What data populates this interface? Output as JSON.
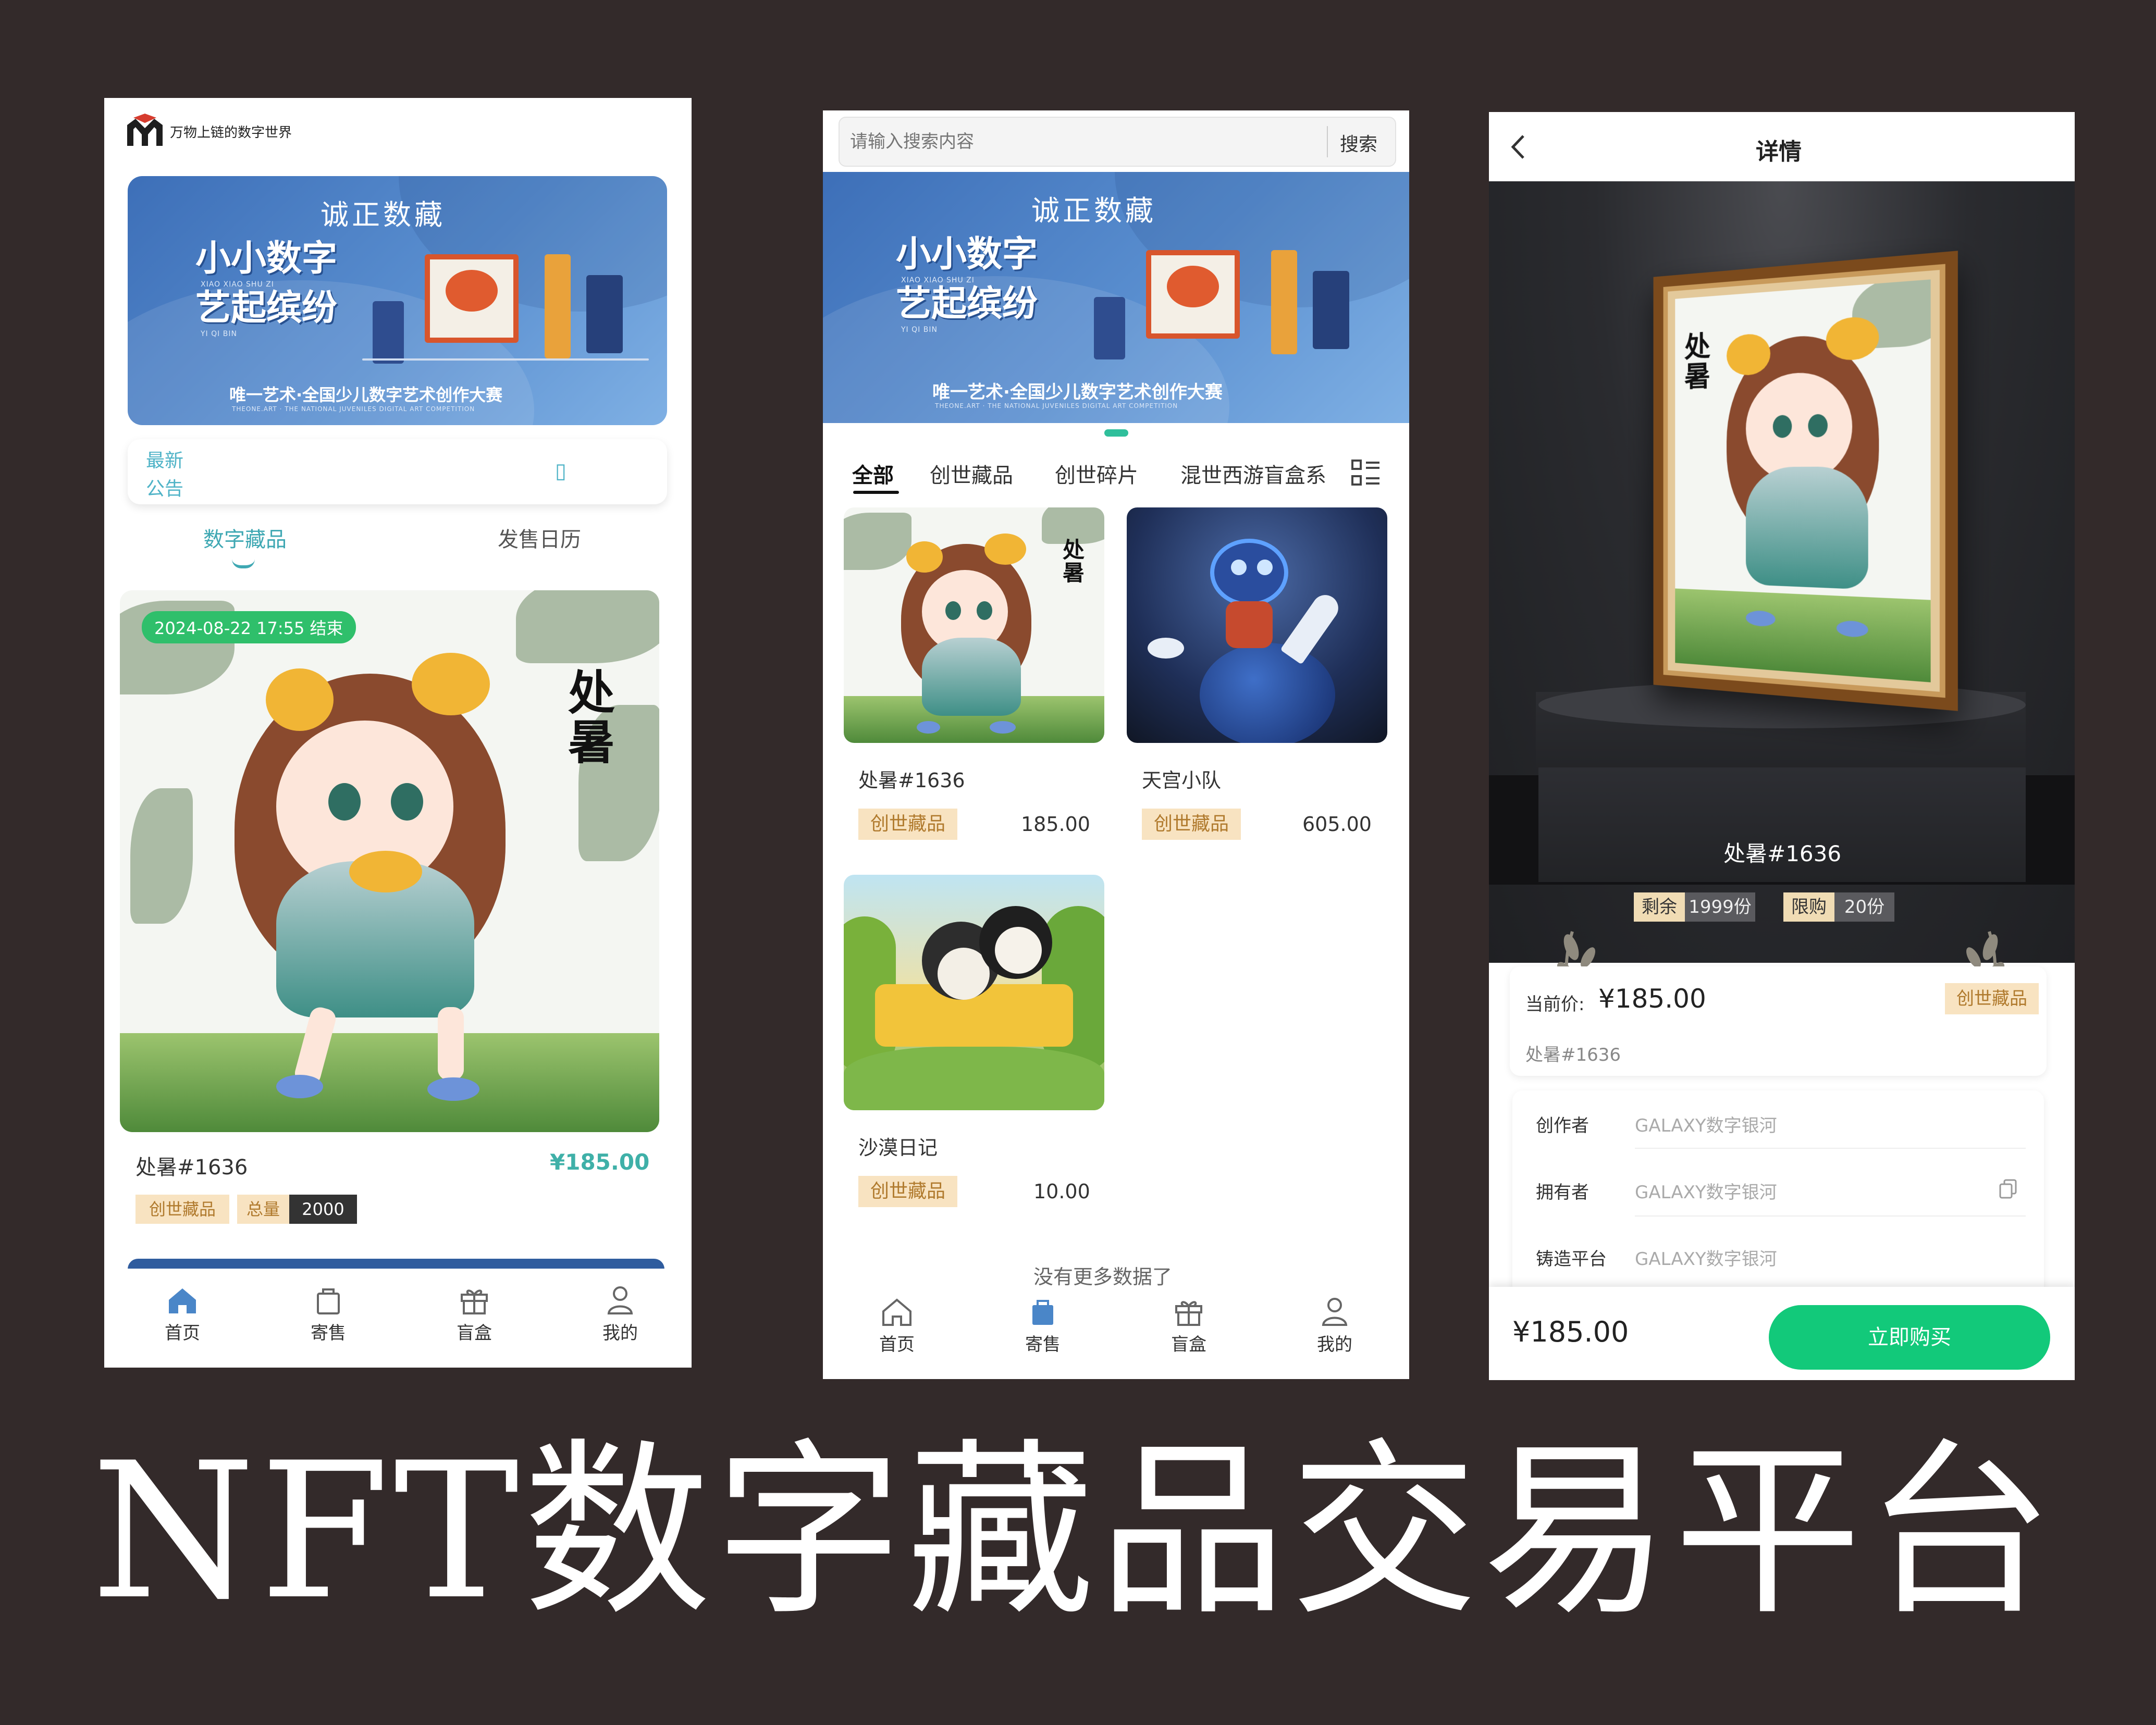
{
  "screen1": {
    "logo_text": "万物上链的数字世界",
    "banner": {
      "brand": "诚正数藏",
      "title_line1": "小小数字",
      "title_line2": "艺起缤纷",
      "pinyin1": "XIAO XIAO SHU ZI",
      "pinyin2": "YI QI BIN",
      "tagline": "唯一艺术·全国少儿数字艺术创作大赛",
      "subline": "THEONE.ART · THE NATIONAL JUVENILES DIGITAL ART COMPETITION"
    },
    "notice": {
      "line1": "最新",
      "line2": "公告",
      "glyph": "▯"
    },
    "tabs": [
      "数字藏品",
      "发售日历"
    ],
    "card": {
      "end_badge": "2024-08-22 17:55 结束",
      "calligraphy": "处暑",
      "name": "处暑#1636",
      "price": "¥185.00",
      "tag": "创世藏品",
      "total_label": "总量",
      "total_value": "2000"
    },
    "nav": [
      "首页",
      "寄售",
      "盲盒",
      "我的"
    ]
  },
  "screen2": {
    "search_placeholder": "请输入搜索内容",
    "search_button": "搜索",
    "banner": {
      "brand": "诚正数藏",
      "title_line1": "小小数字",
      "title_line2": "艺起缤纷",
      "pinyin1": "XIAO XIAO SHU ZI",
      "pinyin2": "YI QI BIN",
      "tagline": "唯一艺术·全国少儿数字艺术创作大赛",
      "subline": "THEONE.ART · THE NATIONAL JUVENILES DIGITAL ART COMPETITION"
    },
    "categories": [
      "全部",
      "创世藏品",
      "创世碎片",
      "混世西游盲盒系"
    ],
    "items": [
      {
        "name": "处暑#1636",
        "tag": "创世藏品",
        "price": "185.00",
        "calligraphy": "处暑"
      },
      {
        "name": "天宫小队",
        "tag": "创世藏品",
        "price": "605.00"
      },
      {
        "name": "沙漠日记",
        "tag": "创世藏品",
        "price": "10.00"
      }
    ],
    "no_more": "没有更多数据了",
    "nav": [
      "首页",
      "寄售",
      "盲盒",
      "我的"
    ]
  },
  "screen3": {
    "header_title": "详情",
    "calligraphy": "处暑",
    "item_name": "处暑#1636",
    "remain_label": "剩余",
    "remain_value": "1999份",
    "limit_label": "限购",
    "limit_value": "20份",
    "price_label": "当前价:",
    "price": "¥185.00",
    "tag": "创世藏品",
    "sub_name": "处暑#1636",
    "info": [
      {
        "label": "创作者",
        "value": "GALAXY数字银河"
      },
      {
        "label": "拥有者",
        "value": "GALAXY数字银河"
      },
      {
        "label": "铸造平台",
        "value": "GALAXY数字银河"
      }
    ],
    "bottom_price": "¥185.00",
    "buy_button": "立即购买"
  },
  "caption": "NFT数字藏品交易平台",
  "colors": {
    "background": "#332a2a",
    "banner_blue": "#4a7cc4",
    "accent_teal": "#3fb0a8",
    "buy_green": "#12c97a",
    "tag_bg": "#f8e3c1",
    "tag_text": "#b07a2d",
    "dark_stage": "#2a2b2f"
  },
  "icons": {
    "nav": [
      "home-icon",
      "bag-icon",
      "gift-icon",
      "user-icon"
    ],
    "back": "chevron-left-icon",
    "copy": "copy-icon",
    "list_toggle": "list-grid-icon"
  }
}
